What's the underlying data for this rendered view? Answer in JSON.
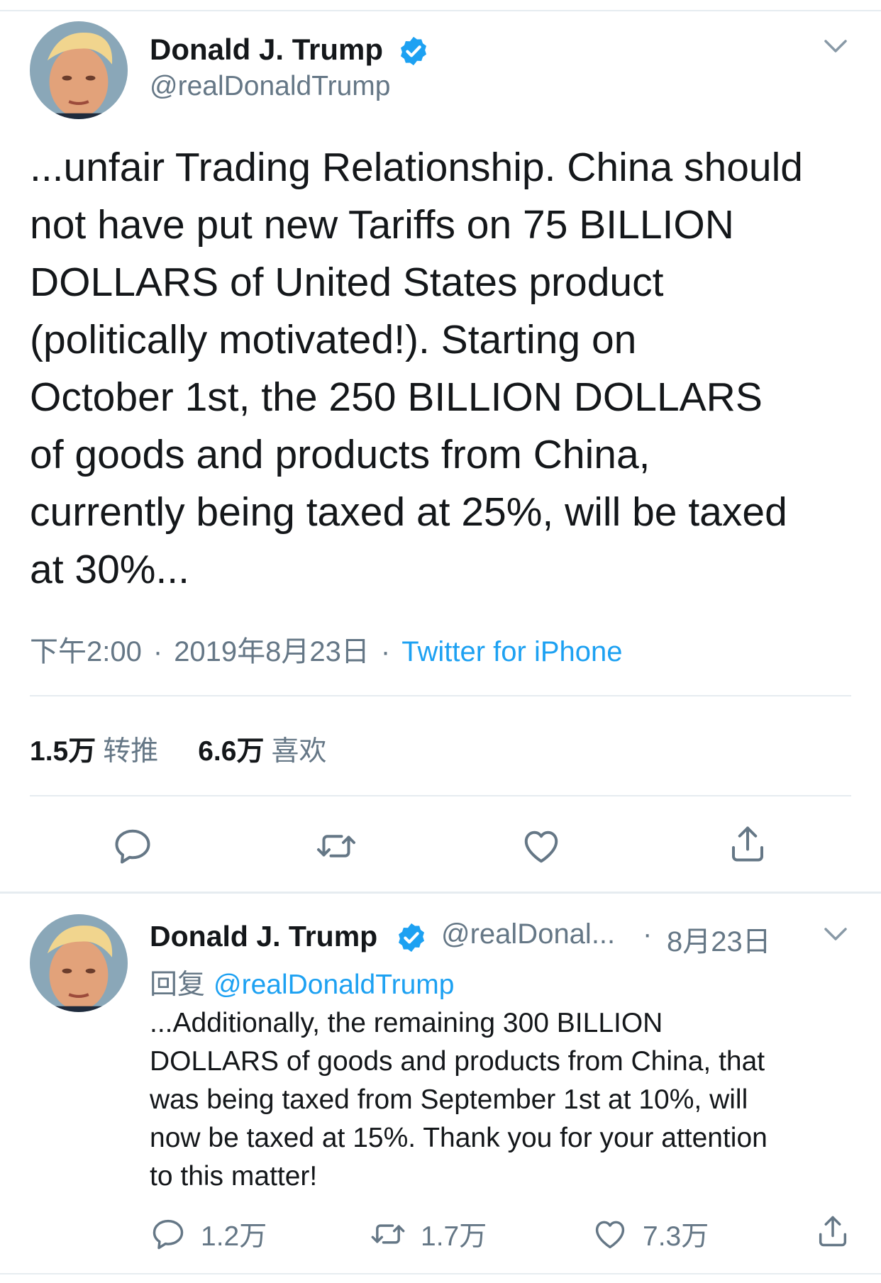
{
  "main_tweet": {
    "author_name": "Donald J. Trump",
    "handle": "@realDonaldTrump",
    "text": "...unfair Trading Relationship. China should\nnot have put new Tariffs on 75 BILLION\nDOLLARS of United States product\n(politically motivated!). Starting on\nOctober 1st, the 250 BILLION DOLLARS\nof goods and products from China,\ncurrently being taxed at 25%, will be taxed\nat 30%...",
    "time": "下午2:00",
    "date": "2019年8月23日",
    "source": "Twitter for iPhone",
    "retweets_count": "1.5万",
    "retweets_label": "转推",
    "likes_count": "6.6万",
    "likes_label": "喜欢"
  },
  "reply_tweet": {
    "author_name": "Donald J. Trump",
    "handle": "@realDonal...",
    "separator": "·",
    "date": "8月23日",
    "replying_label": "回复",
    "replying_to": "@realDonaldTrump",
    "text": "...Additionally, the remaining 300 BILLION\nDOLLARS of goods and products from China, that\nwas being taxed from September 1st at 10%, will\nnow be taxed at 15%. Thank you for your attention\nto this matter!",
    "reply_count": "1.2万",
    "retweet_count": "1.7万",
    "like_count": "7.3万"
  },
  "icons": {
    "verified": "verified-badge-icon",
    "chevron": "chevron-down-icon",
    "reply": "reply-icon",
    "retweet": "retweet-icon",
    "like": "heart-icon",
    "share": "share-icon"
  },
  "colors": {
    "text": "#14171a",
    "secondary": "#657786",
    "accent": "#1da1f2",
    "divider": "#e6ecf0"
  }
}
